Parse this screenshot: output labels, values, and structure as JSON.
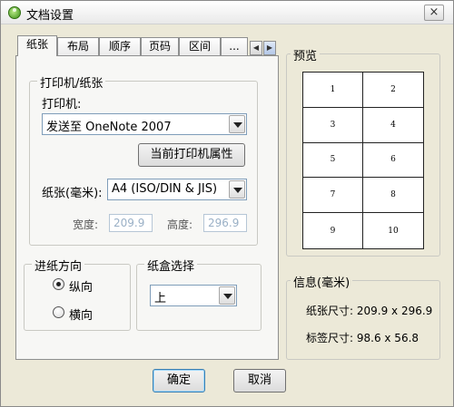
{
  "window": {
    "title": "文档设置",
    "close_label": "×"
  },
  "tabs": [
    {
      "label": "纸张",
      "active": true
    },
    {
      "label": "布局"
    },
    {
      "label": "顺序"
    },
    {
      "label": "页码"
    },
    {
      "label": "区间"
    },
    {
      "label": "..."
    }
  ],
  "tab_scroll": {
    "left": "◀",
    "right": "▶"
  },
  "printer_group": {
    "title": "打印机/纸张",
    "printer_label": "打印机:",
    "printer_value": "发送至 OneNote 2007",
    "properties_button": "当前打印机属性",
    "paper_label": "纸张(毫米):",
    "paper_value": "A4 (ISO/DIN & JIS)",
    "width_label": "宽度:",
    "width_value": "209.9",
    "height_label": "高度:",
    "height_value": "296.9"
  },
  "orientation_group": {
    "title": "进纸方向",
    "options": [
      {
        "label": "纵向",
        "checked": true
      },
      {
        "label": "横向",
        "checked": false
      }
    ]
  },
  "tray_group": {
    "title": "纸盒选择",
    "value": "上"
  },
  "preview": {
    "title": "预览",
    "cells": [
      "1",
      "2",
      "3",
      "4",
      "5",
      "6",
      "7",
      "8",
      "9",
      "10"
    ]
  },
  "info": {
    "title": "信息(毫米)",
    "paper_size": "纸张尺寸: 209.9 x 296.9",
    "label_size": "标签尺寸: 98.6 x 56.8"
  },
  "footer": {
    "ok": "确定",
    "cancel": "取消"
  }
}
